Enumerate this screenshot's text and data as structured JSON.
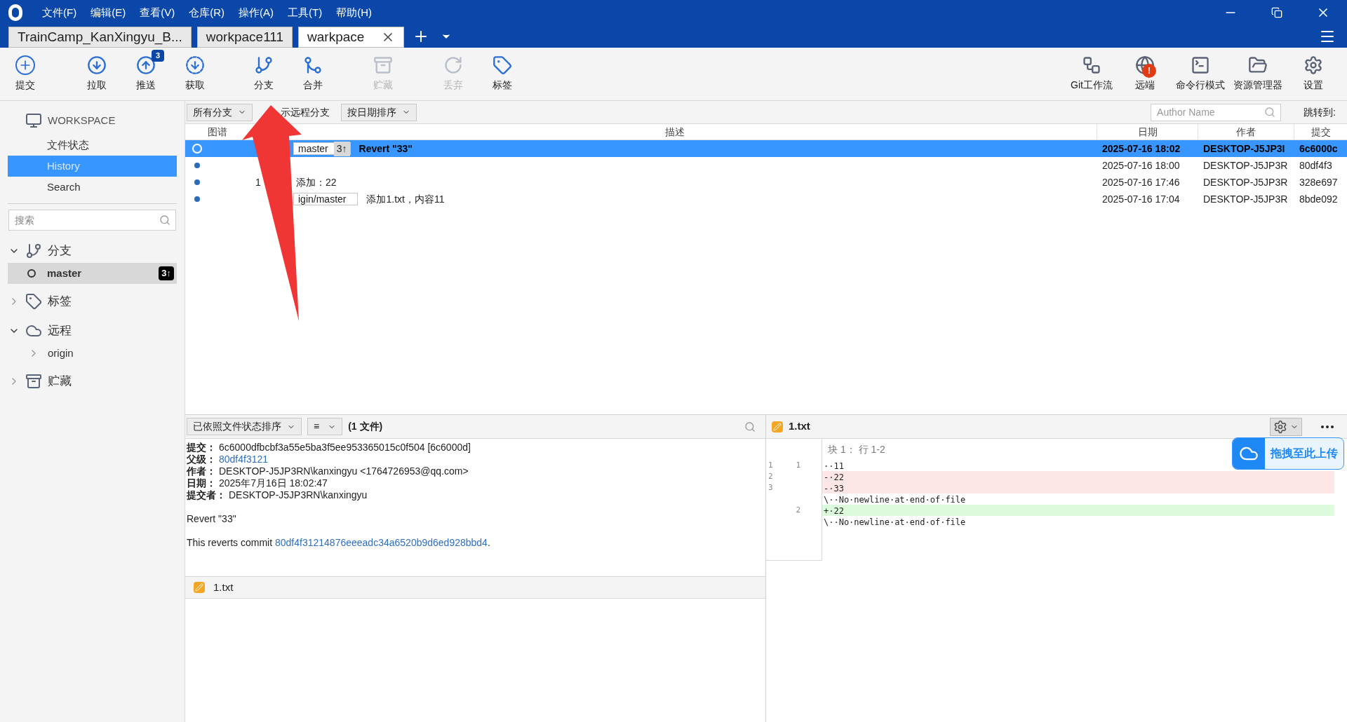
{
  "menu": [
    "文件(F)",
    "编辑(E)",
    "查看(V)",
    "仓库(R)",
    "操作(A)",
    "工具(T)",
    "帮助(H)"
  ],
  "tabs": [
    {
      "label": "TrainCamp_KanXingyu_B...",
      "selected": false,
      "closable": false
    },
    {
      "label": "workpace111",
      "selected": false,
      "closable": false
    },
    {
      "label": "warkpace",
      "selected": true,
      "closable": true
    }
  ],
  "toolbar_left": [
    {
      "kind": "commit",
      "label": "提交",
      "disabled": false
    },
    {
      "kind": "pull",
      "label": "拉取",
      "disabled": false
    },
    {
      "kind": "push",
      "label": "推送",
      "disabled": false,
      "badge": "3"
    },
    {
      "kind": "fetch",
      "label": "获取",
      "disabled": false
    },
    {
      "kind": "branch",
      "label": "分支",
      "disabled": false
    },
    {
      "kind": "merge",
      "label": "合并",
      "disabled": false
    },
    {
      "kind": "stash",
      "label": "贮藏",
      "disabled": true
    },
    {
      "kind": "discard",
      "label": "丢弃",
      "disabled": true
    },
    {
      "kind": "tag",
      "label": "标签",
      "disabled": false
    }
  ],
  "toolbar_right": [
    {
      "kind": "flow",
      "label": "Git工作流"
    },
    {
      "kind": "remote",
      "label": "远端",
      "alert": "!"
    },
    {
      "kind": "terminal",
      "label": "命令行模式"
    },
    {
      "kind": "explorer",
      "label": "资源管理器"
    },
    {
      "kind": "settings",
      "label": "设置"
    }
  ],
  "sidebar": {
    "workspace": "WORKSPACE",
    "items": [
      {
        "label": "文件状态",
        "selected": false
      },
      {
        "label": "History",
        "selected": true
      },
      {
        "label": "Search",
        "selected": false
      }
    ],
    "search": {
      "placeholder": "搜索"
    },
    "sections": [
      {
        "kind": "branch",
        "label": "分支",
        "expanded": true,
        "children": [
          {
            "label": "master",
            "current": true,
            "badge": "3↑"
          }
        ]
      },
      {
        "kind": "tag",
        "label": "标签",
        "expanded": false
      },
      {
        "kind": "remote",
        "label": "远程",
        "expanded": true,
        "children": [
          {
            "label": "origin",
            "expanded": false
          }
        ]
      },
      {
        "kind": "stash",
        "label": "贮藏",
        "expanded": false
      }
    ]
  },
  "filters": {
    "branches": "所有分支",
    "show_remote": "示远程分支",
    "sort": "按日期排序",
    "author": {
      "placeholder": "Author Name"
    },
    "jump": "跳转到:"
  },
  "table": {
    "columns": [
      "图谱",
      "描述",
      "日期",
      "作者",
      "提交"
    ],
    "rows": [
      {
        "selected": true,
        "tags": [
          {
            "label": "master",
            "badge": "3↑"
          }
        ],
        "message": "Revert \"33\"",
        "date": "2025-07-16 18:02",
        "author": "DESKTOP-J5JP3I",
        "commit": "6c6000c"
      },
      {
        "selected": false,
        "tags": [],
        "date": "2025-07-16 18:00",
        "author": "DESKTOP-J5JP3R",
        "commit": "80df4f3"
      },
      {
        "selected": false,
        "tags": [],
        "prefix": "1",
        "message_visible_part": "添加：22",
        "date": "2025-07-16 17:46",
        "author": "DESKTOP-J5JP3R",
        "commit": "328e697"
      },
      {
        "selected": false,
        "tags": [
          {
            "label": "igin/master"
          }
        ],
        "message": "添加1.txt，内容11",
        "date": "2025-07-16 17:04",
        "author": "DESKTOP-J5JP3R",
        "commit": "8bde092"
      }
    ]
  },
  "files_bar": {
    "sort": "已依照文件状态排序",
    "view": "≡",
    "count": "(1 文件)"
  },
  "details": [
    {
      "label": "提交：",
      "value": "6c6000dfbcbf3a55e5ba3f5ee953365015c0f504 [6c6000d]",
      "link": false
    },
    {
      "label": "父级：",
      "value": "80df4f3121",
      "link": true
    },
    {
      "label": "作者：",
      "value": "DESKTOP-J5JP3RN\\kanxingyu <1764726953@qq.com>",
      "link": false
    },
    {
      "label": "日期：",
      "value": "2025年7月16日 18:02:47",
      "link": false
    },
    {
      "label": "提交者：",
      "value": "DESKTOP-J5JP3RN\\kanxingyu",
      "link": false
    }
  ],
  "message": {
    "title": "Revert \"33\"",
    "body": "This reverts commit ",
    "link": "80df4f31214876eeeadc34a6520b9d6ed928bbd4",
    "tail": "."
  },
  "files": [
    {
      "name": "1.txt"
    }
  ],
  "diff": {
    "file": "1.txt",
    "hunk": "块 1： 行 1-2",
    "lines": [
      {
        "kind": "context",
        "old": "1",
        "new": "1",
        "text": "··11"
      },
      {
        "kind": "removed",
        "old": "2",
        "text": "-·22"
      },
      {
        "kind": "removed",
        "old": "3",
        "text": "-·33"
      },
      {
        "kind": "note",
        "text": "\\··No·newline·at·end·of·file"
      },
      {
        "kind": "added",
        "new": "2",
        "text": "+·22"
      },
      {
        "kind": "note",
        "text": "\\··No·newline·at·end·of·file"
      }
    ]
  },
  "upload": {
    "label": "拖拽至此上传"
  }
}
